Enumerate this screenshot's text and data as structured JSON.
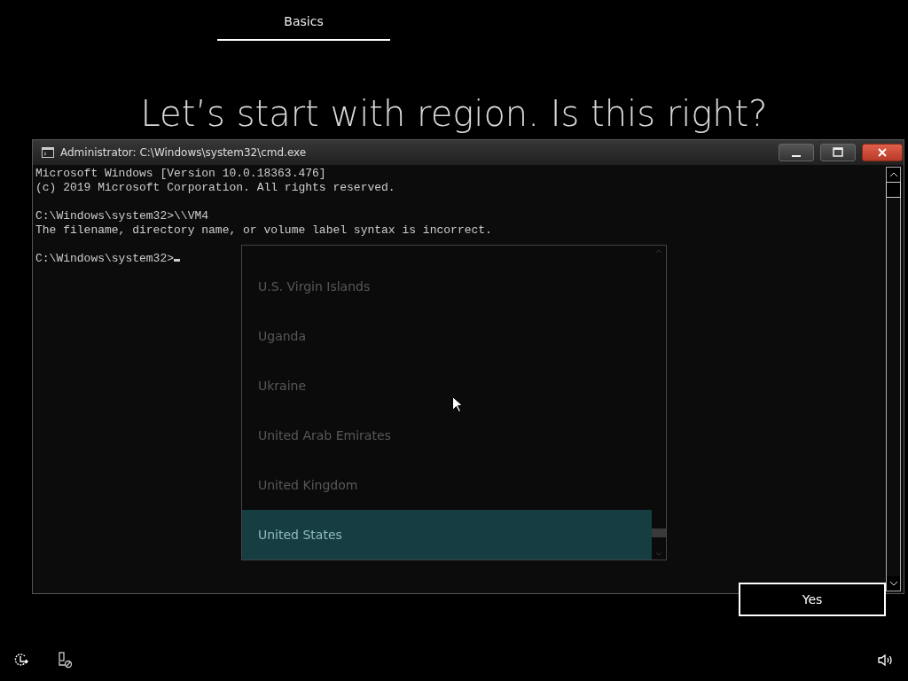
{
  "header": {
    "tabs": [
      {
        "label": "Basics",
        "selected": true
      }
    ]
  },
  "heading": "Let’s start with region. Is this right?",
  "console": {
    "title": "Administrator: C:\\Windows\\system32\\cmd.exe",
    "blocks": [
      [
        "Microsoft Windows [Version 10.0.18363.476]",
        "(c) 2019 Microsoft Corporation. All rights reserved."
      ],
      [
        "C:\\Windows\\system32>\\\\VM4",
        "The filename, directory name, or volume label syntax is incorrect."
      ]
    ],
    "prompt": "C:\\Windows\\system32>"
  },
  "regions": [
    {
      "label": "U.S. Virgin Islands",
      "selected": false
    },
    {
      "label": "Uganda",
      "selected": false
    },
    {
      "label": "Ukraine",
      "selected": false
    },
    {
      "label": "United Arab Emirates",
      "selected": false
    },
    {
      "label": "United Kingdom",
      "selected": false
    },
    {
      "label": "United States",
      "selected": true
    }
  ],
  "buttons": [
    {
      "label": "Yes"
    }
  ]
}
